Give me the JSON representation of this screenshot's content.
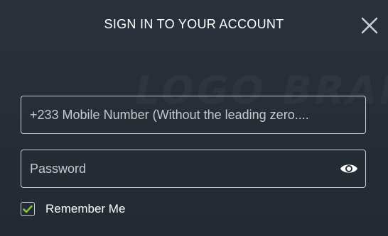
{
  "dialog": {
    "title": "SIGN IN TO YOUR ACCOUNT",
    "close_icon": "close-icon",
    "watermark_text": "LOGO BRAND"
  },
  "form": {
    "mobile": {
      "placeholder": "+233 Mobile Number (Without the leading zero....",
      "value": ""
    },
    "password": {
      "placeholder": "Password",
      "value": "",
      "toggle_icon": "eye-icon"
    },
    "remember": {
      "label": "Remember Me",
      "checked": true,
      "check_icon": "checkmark-icon"
    }
  },
  "colors": {
    "background": "#272d35",
    "text": "#ffffff",
    "field_border": "#c9ccd0",
    "check_accent": "#7ec242"
  }
}
